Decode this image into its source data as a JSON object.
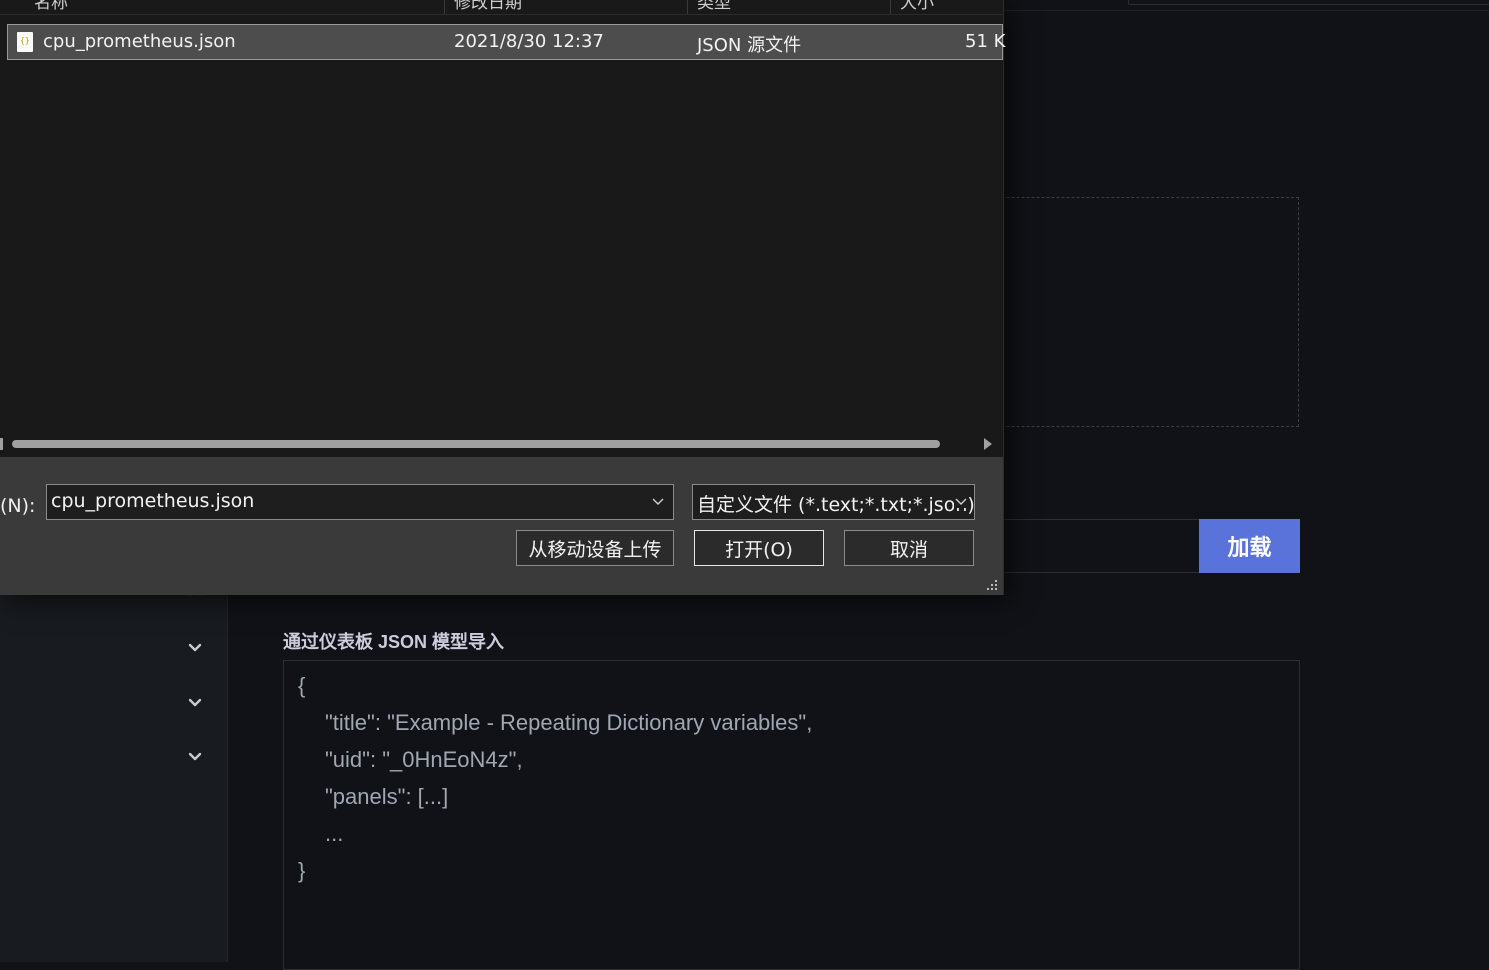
{
  "background": {
    "load_button_label": "加载",
    "json_import_label": "通过仪表板 JSON 模型导入",
    "json_editor_lines": [
      "{",
      "\"title\": \"Example - Repeating Dictionary variables\",",
      "\"uid\": \"_0HnEoN4z\",",
      "\"panels\": [...]",
      "...",
      "}"
    ],
    "sidebar_icons": [
      "chevron-up-icon",
      "chevron-down-icon",
      "chevron-down-icon",
      "chevron-down-icon"
    ],
    "accent_color": "#5a73db"
  },
  "dialog": {
    "columns": [
      "名称",
      "修改日期",
      "类型",
      "大小"
    ],
    "files": [
      {
        "name": "cpu_prometheus.json",
        "modified": "2021/8/30 12:37",
        "type": "JSON 源文件",
        "size": "51 K"
      }
    ],
    "filename_label": "名(N):",
    "filename_value": "cpu_prometheus.json",
    "filter_value": "自定义文件 (*.text;*.txt;*.json)",
    "upload_mobile_label": "从移动设备上传",
    "open_label": "打开(O)",
    "cancel_label": "取消"
  }
}
